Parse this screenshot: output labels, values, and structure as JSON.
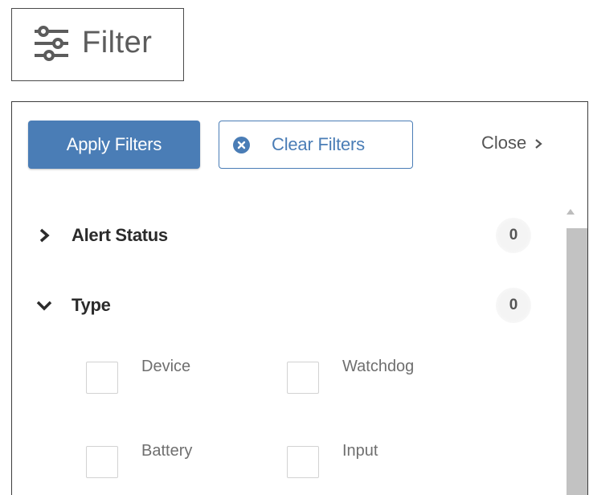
{
  "filter_toggle": {
    "label": "Filter",
    "icon": "sliders-icon"
  },
  "panel": {
    "apply_label": "Apply Filters",
    "clear_label": "Clear Filters",
    "close_label": "Close",
    "sections": [
      {
        "label": "Alert Status",
        "count": "0",
        "expanded": false
      },
      {
        "label": "Type",
        "count": "0",
        "expanded": true
      }
    ],
    "type_options": [
      "Device",
      "Watchdog",
      "Battery",
      "Input"
    ]
  },
  "colors": {
    "accent": "#4a7db6",
    "scrollbar": "#c2c2c2"
  }
}
